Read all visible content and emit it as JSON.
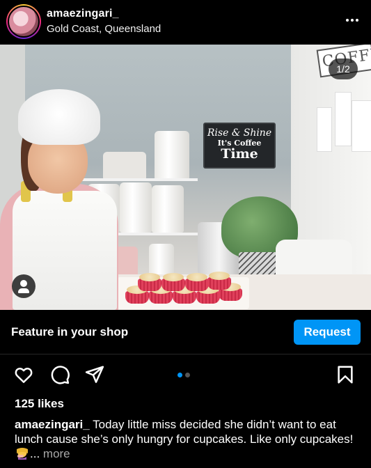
{
  "post": {
    "username": "amaezingari_",
    "location": "Gold Coast, Queensland",
    "more_icon": "more-horizontal-icon"
  },
  "photo": {
    "counter": "1/2",
    "sign_line1": "Rise & Shine",
    "sign_line2": "It's Coffee",
    "sign_line3": "Time",
    "coffee_sign": "COFFEE",
    "user_tag_icon": "person-icon"
  },
  "shop": {
    "label": "Feature in your shop",
    "request_label": "Request",
    "accent": "#0095f6"
  },
  "actions": {
    "like_icon": "heart-icon",
    "comment_icon": "comment-icon",
    "share_icon": "send-icon",
    "save_icon": "bookmark-icon",
    "carousel_total": 2,
    "carousel_active": 1
  },
  "likes": "125 likes",
  "caption": {
    "user": "amaezingari_",
    "text": " Today little miss decided she didn’t want to eat lunch cause she’s only hungry for cupcakes. Like only cupcakes! ",
    "emoji": "person-facepalming-emoji",
    "more_prefix": "... ",
    "more_label": "more"
  }
}
